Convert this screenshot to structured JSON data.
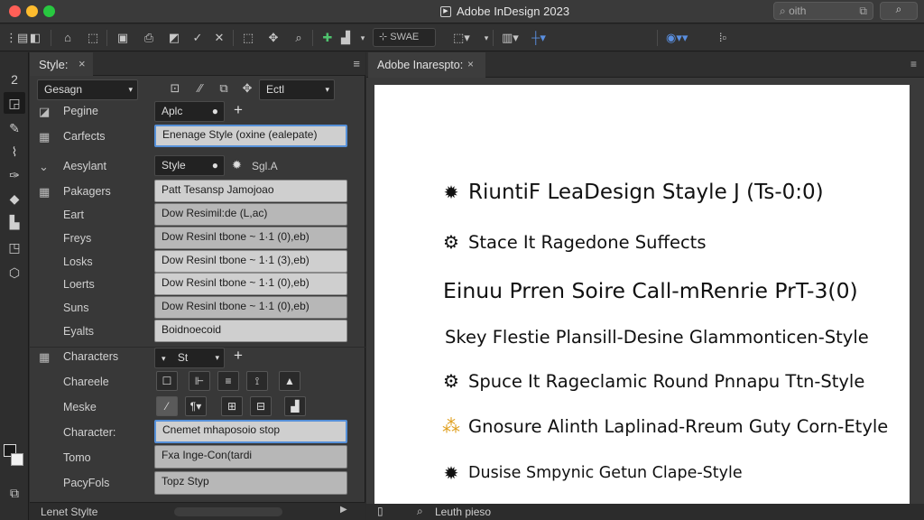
{
  "window": {
    "title": "Adobe InDesign 2023",
    "search_placeholder": "oith"
  },
  "colors": {
    "accent": "#5690d8",
    "close": "#ff5f57",
    "minimize": "#febc2e",
    "zoom": "#28c840"
  },
  "toolbar": {
    "field1": "SWAE",
    "icons": [
      "selection-tool-icon",
      "direct-select-icon",
      "home-icon",
      "frame-icon",
      "image-icon",
      "print-icon",
      "check-icon",
      "pen-icon",
      "transform-icon",
      "rotate-icon",
      "zoom-icon",
      "add-icon",
      "chart-icon",
      "align-icon",
      "grid-icon",
      "plus-cross-icon",
      "color-icon",
      "type-icon"
    ]
  },
  "left_panel": {
    "tab_label": "Style:",
    "tab_close": "×",
    "style_dropdown": "Gesagn",
    "edit_dropdown": "Ectl",
    "rows": {
      "pegine": {
        "label": "Pegine",
        "value": "Aplc"
      },
      "carfects": {
        "label": "Carfects",
        "value": "Enenage Style (oxine (ealepate)"
      },
      "aesylant": {
        "label": "Aesylant",
        "value": "Style",
        "extra": "Sgl.A"
      },
      "pakagers": {
        "label": "Pakagers",
        "value": "Patt Tesansp Jamojoao"
      },
      "eart": {
        "label": "Eart",
        "value": "Dow Resimil:de (L,ac)"
      },
      "freys": {
        "label": "Freys",
        "value": "Dow Resinl tbone ~ 1·1 (0),eb)"
      },
      "losks": {
        "label": "Losks",
        "value": "Dow Resinl tbone ~ 1·1 (3),eb)"
      },
      "loerts": {
        "label": "Loerts",
        "value": "Dow Resinl tbone ~ 1·1 (0),eb)"
      },
      "suns": {
        "label": "Suns",
        "value": "Dow Resinl tbone ~ 1·1 (0),eb)"
      },
      "eyalts": {
        "label": "Eyalts",
        "value": "Boidnoecoid"
      }
    },
    "characters": {
      "header": "Characters",
      "dropdown": "St",
      "chareele": "Chareele",
      "meske": "Meske",
      "character": {
        "label": "Character:",
        "value": "Cnemet mhaposoio stop"
      },
      "tomo": {
        "label": "Tomo",
        "value": "Fxa Inge-Con(tardi"
      },
      "pacyfols": {
        "label": "PacyFols",
        "value": "Topz Styp"
      }
    },
    "footer": "Lenet Stylte"
  },
  "document": {
    "tab_label": "Adobe Inarespto:",
    "tab_close": "×",
    "status": "Leuth pieso",
    "lines": [
      {
        "symbol": "sun-icon",
        "text": "RiuntiF LeaDesign Stayle  J (Ts-0:0)"
      },
      {
        "symbol": "gear-sun-icon",
        "text": "Stace It Ragedone Suffects"
      },
      {
        "symbol": "",
        "text": "Einuu Prren Soire Call-mRenrie PrT-3(0)"
      },
      {
        "symbol": "",
        "text": "Skey Flestie Plansill-Desine Glammonticen-Style"
      },
      {
        "symbol": "gear-sun-icon",
        "text": "Spuce It Rageclamic Round Pnnapu Ttn-Style"
      },
      {
        "symbol": "star-dots-icon",
        "text": "Gnosure Alinth Laplinad-Rreum Guty Corn-Etyle"
      },
      {
        "symbol": "sun-icon",
        "text": "Dusise Smpynic Getun Clape-Style"
      }
    ]
  }
}
